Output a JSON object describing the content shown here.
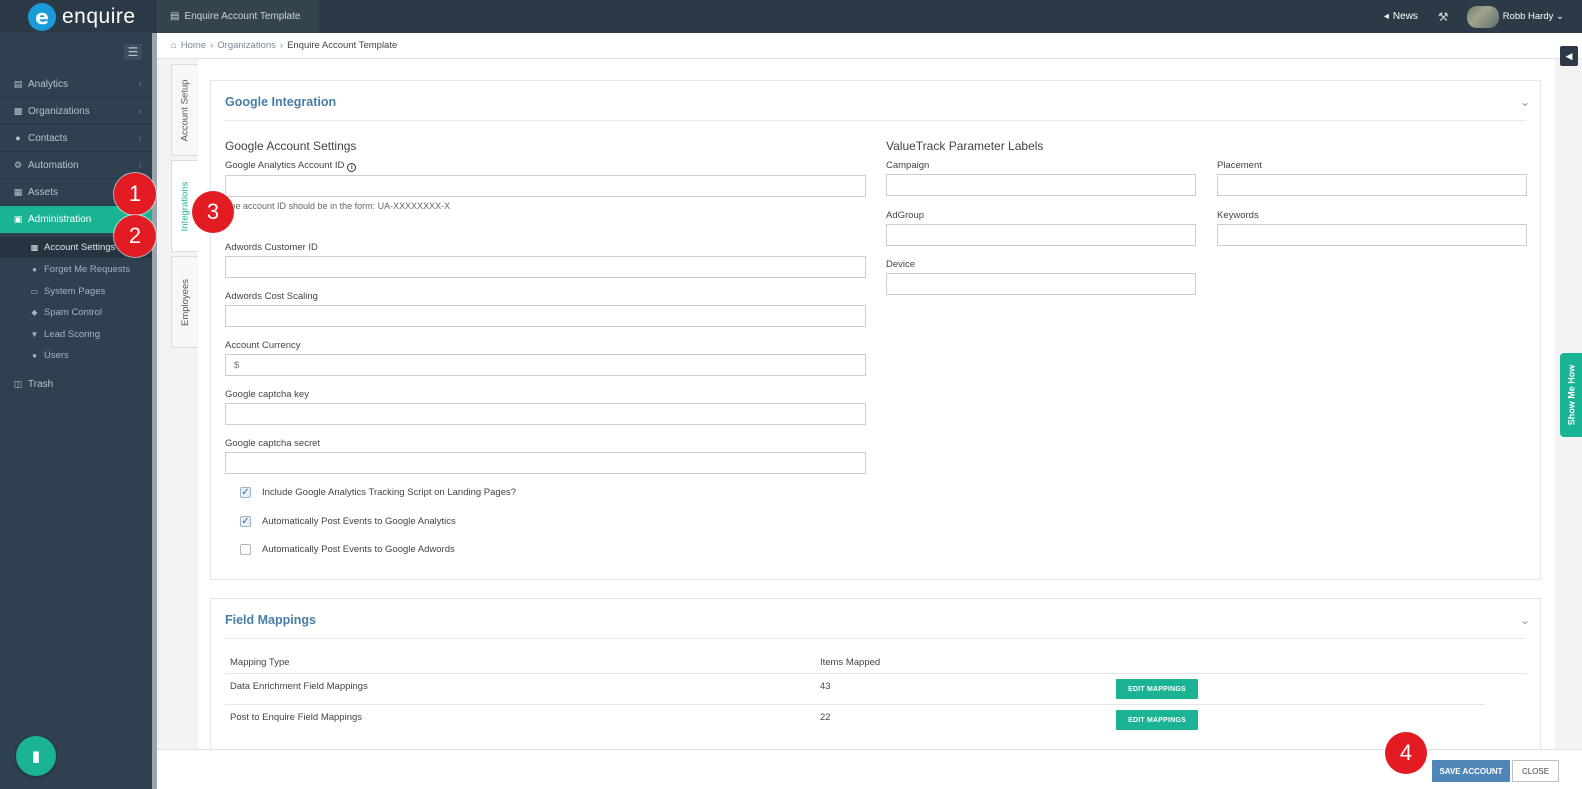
{
  "app": {
    "logo_text": "enquire",
    "logo_letter": "e"
  },
  "top_tab": "Enquire Account Template",
  "topbar": {
    "news_label": "News",
    "user_name": "Robb Hardy"
  },
  "sidebar": {
    "items": [
      {
        "label": "Analytics"
      },
      {
        "label": "Organizations"
      },
      {
        "label": "Contacts"
      },
      {
        "label": "Automation"
      },
      {
        "label": "Assets"
      },
      {
        "label": "Administration"
      }
    ],
    "sub_items": [
      {
        "label": "Account Settings"
      },
      {
        "label": "Forget Me Requests"
      },
      {
        "label": "System Pages"
      },
      {
        "label": "Spam Control"
      },
      {
        "label": "Lead Scoring"
      },
      {
        "label": "Users"
      }
    ],
    "trash_label": "Trash"
  },
  "breadcrumb": {
    "home": "Home",
    "organizations": "Organizations",
    "current": "Enquire Account Template"
  },
  "vertical_tabs": {
    "account_setup": "Account Setup",
    "integrations": "Integrations",
    "employees": "Employees"
  },
  "google_integration": {
    "title": "Google Integration",
    "account_settings_heading": "Google Account Settings",
    "analytics_id_label": "Google Analytics Account ID",
    "analytics_id_help": "The account ID should be in the form: UA-XXXXXXXX-X",
    "adwords_customer_label": "Adwords Customer ID",
    "adwords_scaling_label": "Adwords Cost Scaling",
    "currency_label": "Account Currency",
    "currency_placeholder": "$",
    "captcha_key_label": "Google captcha key",
    "captcha_secret_label": "Google captcha secret",
    "checkboxes": [
      {
        "label": "Include Google Analytics Tracking Script on Landing Pages?",
        "checked": true
      },
      {
        "label": "Automatically Post Events to Google Analytics",
        "checked": true
      },
      {
        "label": "Automatically Post Events to Google Adwords",
        "checked": false
      }
    ],
    "valuetrack_heading": "ValueTrack Parameter Labels",
    "campaign_label": "Campaign",
    "placement_label": "Placement",
    "adgroup_label": "AdGroup",
    "keywords_label": "Keywords",
    "device_label": "Device"
  },
  "field_mappings": {
    "title": "Field Mappings",
    "col_type": "Mapping Type",
    "col_items": "Items Mapped",
    "rows": [
      {
        "type": "Data Enrichment Field Mappings",
        "items": "43",
        "button": "EDIT MAPPINGS"
      },
      {
        "type": "Post to Enquire Field Mappings",
        "items": "22",
        "button": "EDIT MAPPINGS"
      }
    ]
  },
  "footer": {
    "save_label": "SAVE ACCOUNT",
    "close_label": "CLOSE"
  },
  "show_me_how": "Show Me How",
  "markers": [
    "1",
    "2",
    "3",
    "4"
  ],
  "colors": {
    "accent": "#1ab394",
    "sidebar": "#2f4050",
    "topbar": "#2b3a46",
    "primary_btn": "#4f86b8",
    "marker": "#e21c22",
    "panel_title": "#4a7da6"
  }
}
